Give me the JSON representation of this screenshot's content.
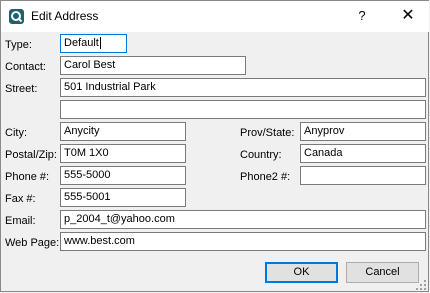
{
  "window": {
    "title": "Edit Address",
    "help_glyph": "?",
    "close_glyph": "✕",
    "app_icon": "app-q-icon"
  },
  "labels": {
    "type": "Type:",
    "contact": "Contact:",
    "street": "Street:",
    "city": "City:",
    "postal": "Postal/Zip:",
    "phone": "Phone #:",
    "fax": "Fax #:",
    "email": "Email:",
    "webpage": "Web Page:",
    "provstate": "Prov/State:",
    "country": "Country:",
    "phone2": "Phone2 #:"
  },
  "fields": {
    "type": "Default",
    "contact": "Carol Best",
    "street1": "501 Industrial Park",
    "street2": "",
    "city": "Anycity",
    "postal": "T0M 1X0",
    "phone": "555-5000",
    "fax": "555-5001",
    "email": "p_2004_t@yahoo.com",
    "webpage": "www.best.com",
    "provstate": "Anyprov",
    "country": "Canada",
    "phone2": ""
  },
  "buttons": {
    "ok": "OK",
    "cancel": "Cancel"
  },
  "colors": {
    "accent": "#0078d7",
    "dialog_bg": "#f0f0f0",
    "titlebar_bg": "#ffffff"
  }
}
